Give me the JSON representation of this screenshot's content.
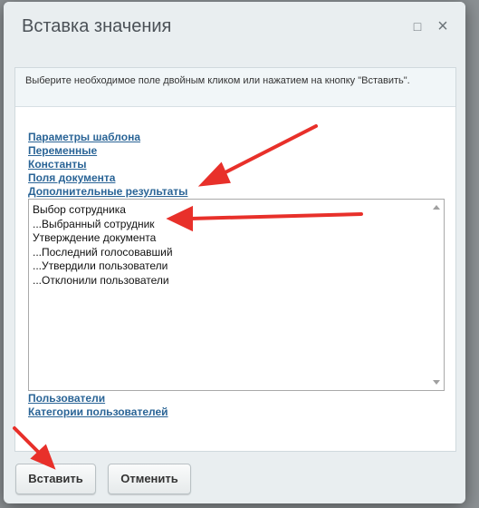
{
  "dialog": {
    "title": "Вставка значения",
    "maximize_glyph": "□",
    "close_glyph": "×"
  },
  "info": {
    "text": "Выберите необходимое поле двойным кликом или нажатием на кнопку \"Вставить\"."
  },
  "categories": [
    "Параметры шаблона",
    "Переменные",
    "Константы",
    "Поля документа",
    "Дополнительные результаты"
  ],
  "list": {
    "items": [
      "Выбор сотрудника",
      "...Выбранный сотрудник",
      "Утверждение документа",
      "...Последний голосовавший",
      "...Утвердили пользователи",
      "...Отклонили пользователи"
    ]
  },
  "bottom_links": [
    "Пользователи",
    "Категории пользователей"
  ],
  "buttons": {
    "insert": "Вставить",
    "cancel": "Отменить"
  },
  "colors": {
    "link": "#2a6496",
    "annotation_arrow": "#e8302a"
  }
}
